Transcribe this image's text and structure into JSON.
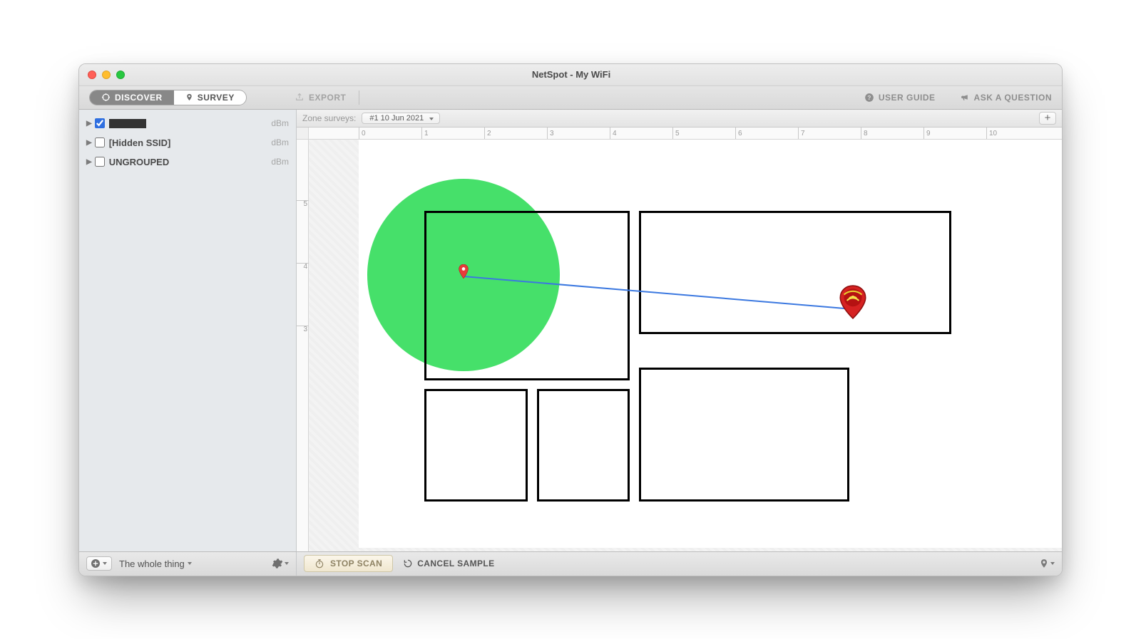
{
  "window": {
    "title": "NetSpot - My WiFi"
  },
  "toolbar": {
    "discover_label": "DISCOVER",
    "survey_label": "SURVEY",
    "export_label": "EXPORT",
    "user_guide_label": "USER GUIDE",
    "ask_label": "ASK A QUESTION"
  },
  "subbar": {
    "zone_label": "Zone surveys:",
    "selected_survey": "#1 10 Jun 2021"
  },
  "ruler_h": [
    "0",
    "1",
    "2",
    "3",
    "4",
    "5",
    "6",
    "7",
    "8",
    "9",
    "10"
  ],
  "ruler_v": [
    "5",
    "4",
    "3"
  ],
  "sidebar": {
    "items": [
      {
        "label_redacted": true,
        "checked": true,
        "unit": "dBm"
      },
      {
        "label": "[Hidden SSID]",
        "checked": false,
        "unit": "dBm"
      },
      {
        "label": "UNGROUPED",
        "checked": false,
        "unit": "dBm"
      }
    ]
  },
  "bottom": {
    "scope_label": "The whole thing",
    "stop_scan_label": "STOP SCAN",
    "cancel_sample_label": "CANCEL SAMPLE"
  }
}
